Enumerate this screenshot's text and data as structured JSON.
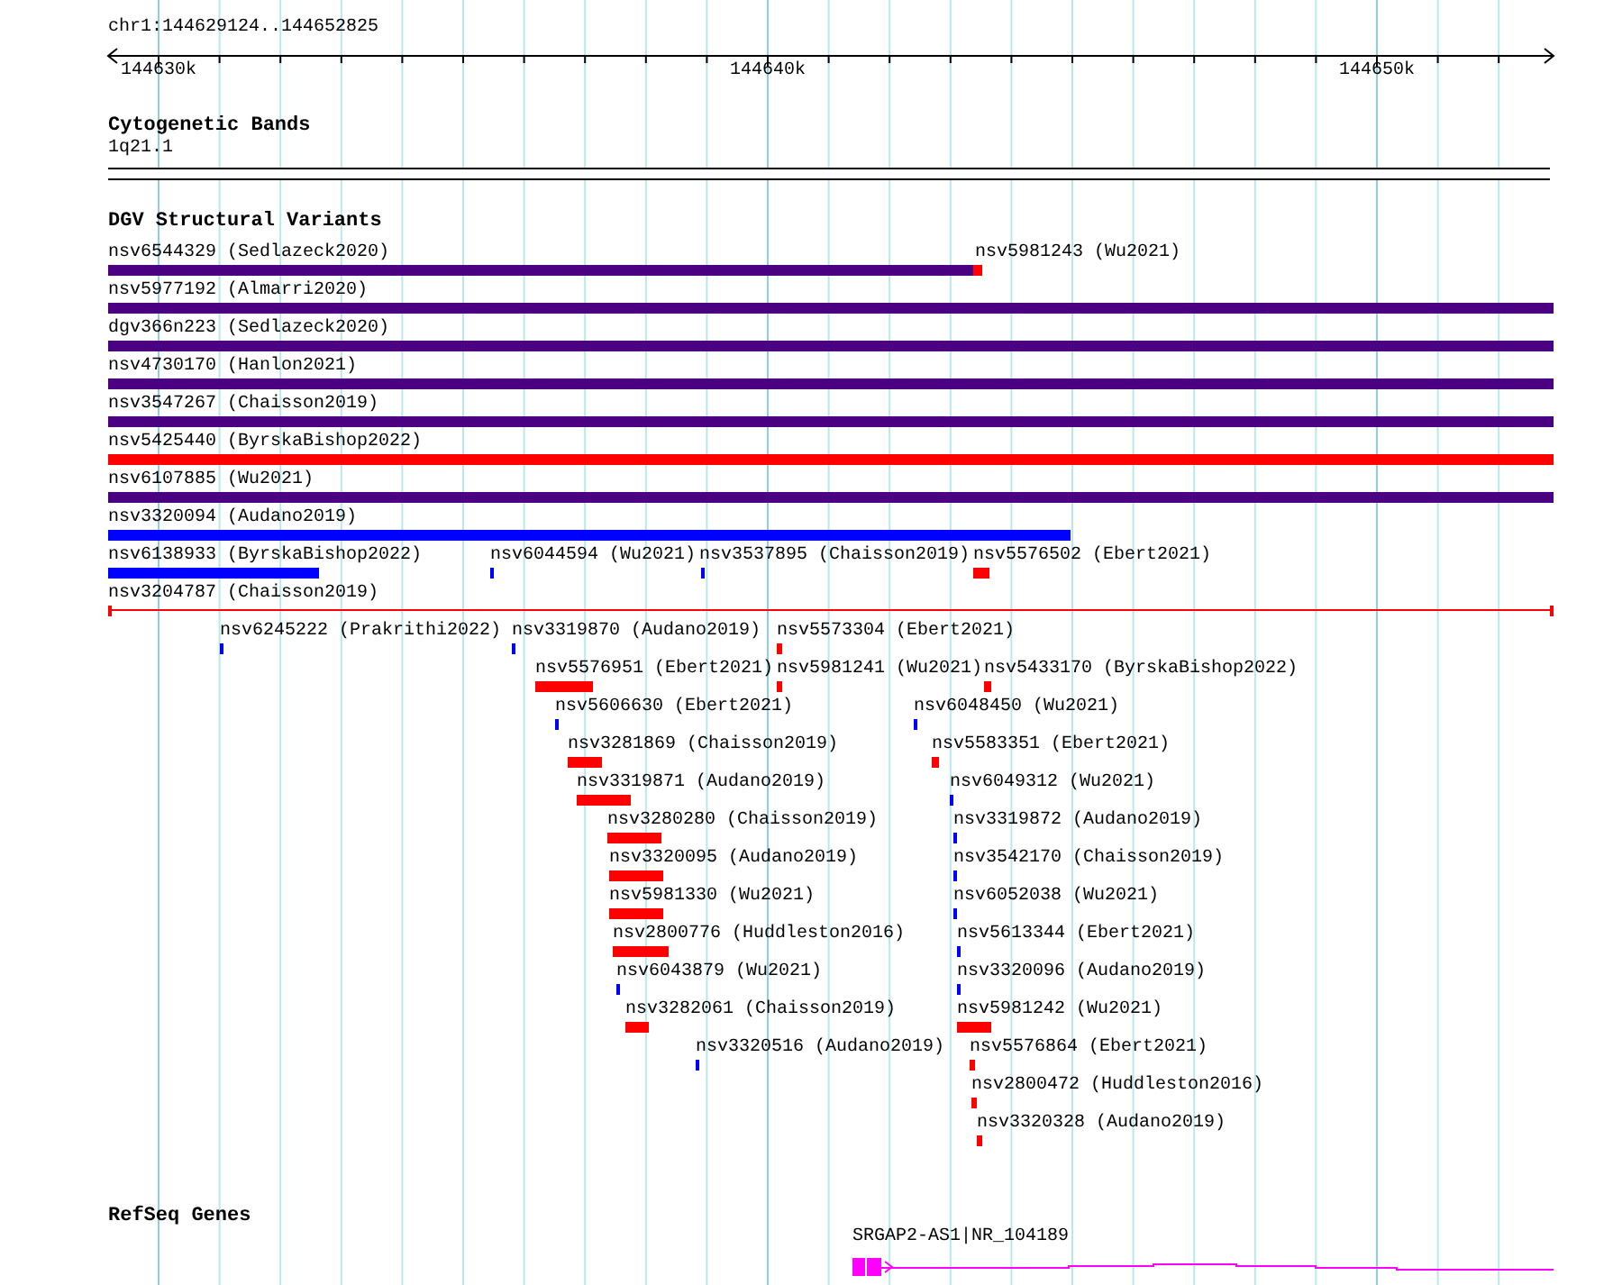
{
  "ruler": {
    "location": "chr1:144629124..144652825",
    "ticks": [
      "144630k",
      "144640k",
      "144650k"
    ]
  },
  "tracks": [
    {
      "title": "Cytogenetic Bands",
      "kind": "bands",
      "features": [
        {
          "label": "1q21.1"
        }
      ]
    },
    {
      "title": "DGV Structural Variants",
      "kind": "variants",
      "features": [
        {
          "label": "nsv6544329 (Sedlazeck2020)",
          "kind": "block",
          "color": "#4b0082"
        },
        {
          "label": "nsv5981243 (Wu2021)",
          "kind": "block",
          "color": "#ff0000"
        },
        {
          "label": "nsv5977192 (Almarri2020)",
          "kind": "block",
          "color": "#4b0082"
        },
        {
          "label": "dgv366n223 (Sedlazeck2020)",
          "kind": "block",
          "color": "#4b0082"
        },
        {
          "label": "nsv4730170 (Hanlon2021)",
          "kind": "block",
          "color": "#4b0082"
        },
        {
          "label": "nsv3547267 (Chaisson2019)",
          "kind": "block",
          "color": "#4b0082"
        },
        {
          "label": "nsv5425440 (ByrskaBishop2022)",
          "kind": "block",
          "color": "#ff0000"
        },
        {
          "label": "nsv6107885 (Wu2021)",
          "kind": "block",
          "color": "#4b0082"
        },
        {
          "label": "nsv3320094 (Audano2019)",
          "kind": "block",
          "color": "#0000ff"
        },
        {
          "label": "nsv6138933 (ByrskaBishop2022)",
          "kind": "block",
          "color": "#0000ff"
        },
        {
          "label": "nsv6044594 (Wu2021)",
          "kind": "block",
          "color": "#0000ff"
        },
        {
          "label": "nsv3537895 (Chaisson2019)",
          "kind": "block",
          "color": "#0000ff"
        },
        {
          "label": "nsv5576502 (Ebert2021)",
          "kind": "block",
          "color": "#ff0000"
        },
        {
          "label": "nsv3204787 (Chaisson2019)",
          "kind": "span",
          "color": "#ff0000"
        },
        {
          "label": "nsv6245222 (Prakrithi2022)",
          "kind": "block",
          "color": "#0000ff"
        },
        {
          "label": "nsv3319870 (Audano2019)",
          "kind": "block",
          "color": "#0000ff"
        },
        {
          "label": "nsv5573304 (Ebert2021)",
          "kind": "block",
          "color": "#ff0000"
        },
        {
          "label": "nsv5576951 (Ebert2021)",
          "kind": "block",
          "color": "#ff0000"
        },
        {
          "label": "nsv5981241 (Wu2021)",
          "kind": "block",
          "color": "#ff0000"
        },
        {
          "label": "nsv5433170 (ByrskaBishop2022)",
          "kind": "block",
          "color": "#ff0000"
        },
        {
          "label": "nsv5606630 (Ebert2021)",
          "kind": "block",
          "color": "#0000ff"
        },
        {
          "label": "nsv6048450 (Wu2021)",
          "kind": "block",
          "color": "#0000ff"
        },
        {
          "label": "nsv3281869 (Chaisson2019)",
          "kind": "block",
          "color": "#ff0000"
        },
        {
          "label": "nsv5583351 (Ebert2021)",
          "kind": "block",
          "color": "#ff0000"
        },
        {
          "label": "nsv3319871 (Audano2019)",
          "kind": "block",
          "color": "#ff0000"
        },
        {
          "label": "nsv6049312 (Wu2021)",
          "kind": "block",
          "color": "#0000ff"
        },
        {
          "label": "nsv3280280 (Chaisson2019)",
          "kind": "block",
          "color": "#ff0000"
        },
        {
          "label": "nsv3319872 (Audano2019)",
          "kind": "block",
          "color": "#0000ff"
        },
        {
          "label": "nsv3320095 (Audano2019)",
          "kind": "block",
          "color": "#ff0000"
        },
        {
          "label": "nsv3542170 (Chaisson2019)",
          "kind": "block",
          "color": "#0000ff"
        },
        {
          "label": "nsv5981330 (Wu2021)",
          "kind": "block",
          "color": "#ff0000"
        },
        {
          "label": "nsv6052038 (Wu2021)",
          "kind": "block",
          "color": "#0000ff"
        },
        {
          "label": "nsv2800776 (Huddleston2016)",
          "kind": "block",
          "color": "#ff0000"
        },
        {
          "label": "nsv5613344 (Ebert2021)",
          "kind": "block",
          "color": "#0000ff"
        },
        {
          "label": "nsv6043879 (Wu2021)",
          "kind": "block",
          "color": "#0000ff"
        },
        {
          "label": "nsv3320096 (Audano2019)",
          "kind": "block",
          "color": "#0000ff"
        },
        {
          "label": "nsv3282061 (Chaisson2019)",
          "kind": "block",
          "color": "#ff0000"
        },
        {
          "label": "nsv5981242 (Wu2021)",
          "kind": "block",
          "color": "#ff0000"
        },
        {
          "label": "nsv3320516 (Audano2019)",
          "kind": "block",
          "color": "#0000ff"
        },
        {
          "label": "nsv5576864 (Ebert2021)",
          "kind": "block",
          "color": "#ff0000"
        },
        {
          "label": "nsv2800472 (Huddleston2016)",
          "kind": "block",
          "color": "#ff0000"
        },
        {
          "label": "nsv3320328 (Audano2019)",
          "kind": "block",
          "color": "#ff0000"
        }
      ]
    },
    {
      "title": "RefSeq Genes",
      "kind": "genes",
      "features": [
        {
          "label": "SRGAP2-AS1|NR_104189",
          "color": "#ff00ff"
        }
      ]
    }
  ]
}
